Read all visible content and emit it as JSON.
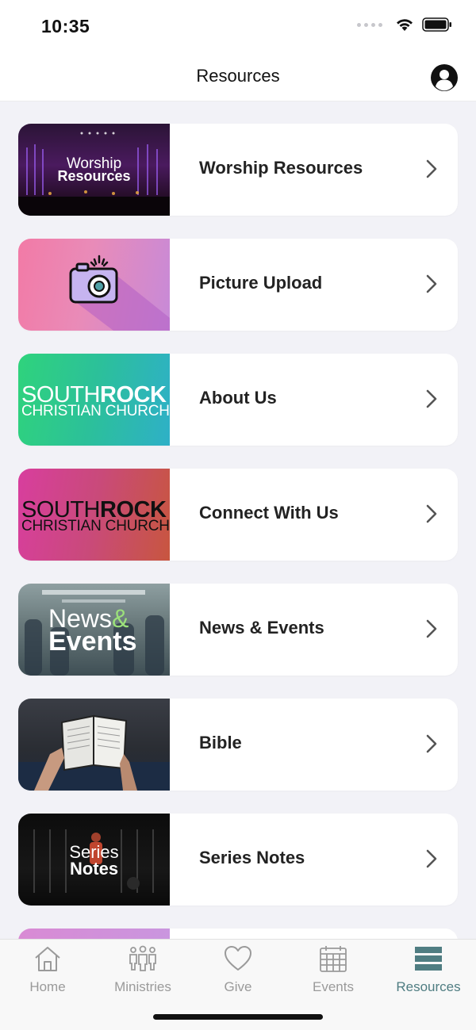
{
  "status_bar": {
    "time": "10:35"
  },
  "nav": {
    "title": "Resources",
    "profile_icon": "profile-icon"
  },
  "resources": [
    {
      "label": "Worship Resources",
      "thumb_lines": [
        "Worship",
        "Resources"
      ]
    },
    {
      "label": "Picture Upload",
      "thumb_icon": "camera-icon"
    },
    {
      "label": "About Us",
      "thumb_lines": [
        "SOUTH",
        "ROCK",
        "CHRISTIAN CHURCH"
      ]
    },
    {
      "label": "Connect With Us",
      "thumb_lines": [
        "SOUTH",
        "ROCK",
        "CHRISTIAN CHURCH"
      ]
    },
    {
      "label": "News & Events",
      "thumb_lines": [
        "News",
        "&",
        "Events"
      ]
    },
    {
      "label": "Bible",
      "thumb_icon": "open-bible-photo"
    },
    {
      "label": "Series Notes",
      "thumb_lines": [
        "Series",
        "Notes"
      ]
    }
  ],
  "tabs": [
    {
      "label": "Home",
      "icon": "home-icon"
    },
    {
      "label": "Ministries",
      "icon": "people-icon"
    },
    {
      "label": "Give",
      "icon": "heart-icon"
    },
    {
      "label": "Events",
      "icon": "calendar-icon"
    },
    {
      "label": "Resources",
      "icon": "list-icon",
      "active": true
    }
  ],
  "colors": {
    "accent": "#4f7d82",
    "inactive": "#9a9a9a",
    "background": "#f2f2f7"
  }
}
